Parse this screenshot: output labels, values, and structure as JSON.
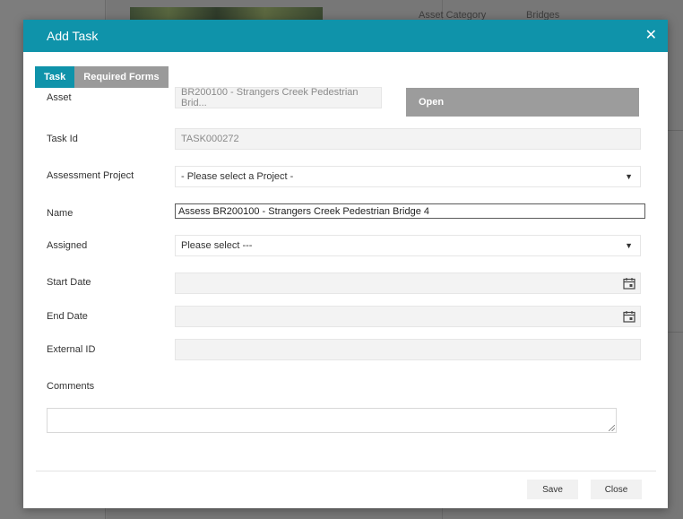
{
  "background": {
    "asset_category_label": "Asset Category",
    "asset_category_value": "Bridges"
  },
  "modal": {
    "title": "Add Task",
    "close_icon": "close-icon",
    "tabs": [
      {
        "label": "Task",
        "active": true
      },
      {
        "label": "Required Forms",
        "active": false
      }
    ],
    "fields": {
      "asset": {
        "label": "Asset",
        "value": "BR200100 - Strangers Creek Pedestrian Brid..."
      },
      "open_button": "Open",
      "task_id": {
        "label": "Task Id",
        "value": "TASK000272"
      },
      "assessment_project": {
        "label": "Assessment Project",
        "value": "- Please select a Project -"
      },
      "name": {
        "label": "Name",
        "value": "Assess BR200100 - Strangers Creek Pedestrian Bridge 4"
      },
      "assigned": {
        "label": "Assigned",
        "value": "Please select ---"
      },
      "start_date": {
        "label": "Start Date",
        "value": ""
      },
      "end_date": {
        "label": "End Date",
        "value": ""
      },
      "external_id": {
        "label": "External ID",
        "value": ""
      },
      "comments": {
        "label": "Comments",
        "value": ""
      }
    },
    "footer": {
      "save_label": "Save",
      "close_label": "Close"
    },
    "colors": {
      "header": "#0f93aa",
      "active_tab": "#0f93aa",
      "inactive_tab": "#9a9a9a",
      "open_button": "#9c9c9c"
    }
  }
}
